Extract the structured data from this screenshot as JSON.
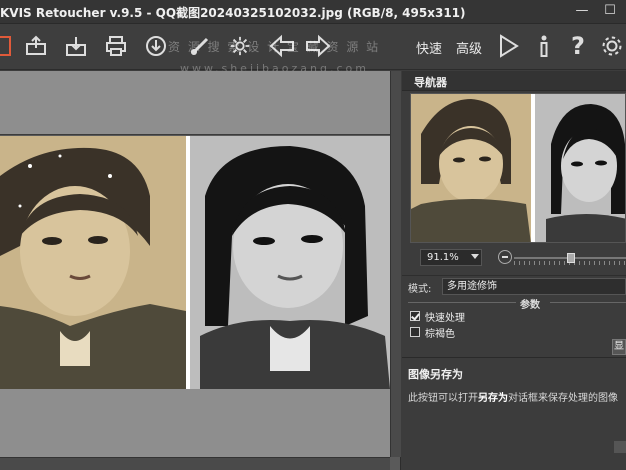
{
  "window": {
    "title": "KVIS Retoucher v.9.5 - QQ截图20240325102032.jpg (RGB/8, 495x311)",
    "minimize": "—",
    "maximize": "☐"
  },
  "toolbar": {
    "quick_label": "快速",
    "advanced_label": "高级"
  },
  "watermark": {
    "line1": "资 源 搜 索 设 计 宝 藏 资 源 站",
    "line2": "www.shejibaozang.com"
  },
  "navigator": {
    "title": "导航器",
    "zoom": "91.1%"
  },
  "settings": {
    "mode_label": "模式:",
    "mode_value": "多用途修饰",
    "params_title": "参数",
    "options": [
      {
        "label": "快速处理",
        "checked": true
      },
      {
        "label": "棕褐色",
        "checked": false
      }
    ],
    "side_button": "显"
  },
  "help": {
    "title": "图像另存为",
    "text_pre": "此按钮可以打开",
    "text_bold": "另存为",
    "text_post": "对话框来保存处理的图像"
  },
  "colors": {
    "background": "#3c3c3c",
    "panel_header": "#333333",
    "canvas_gray": "#8e8e8e",
    "sepia": "#c9b48a"
  }
}
